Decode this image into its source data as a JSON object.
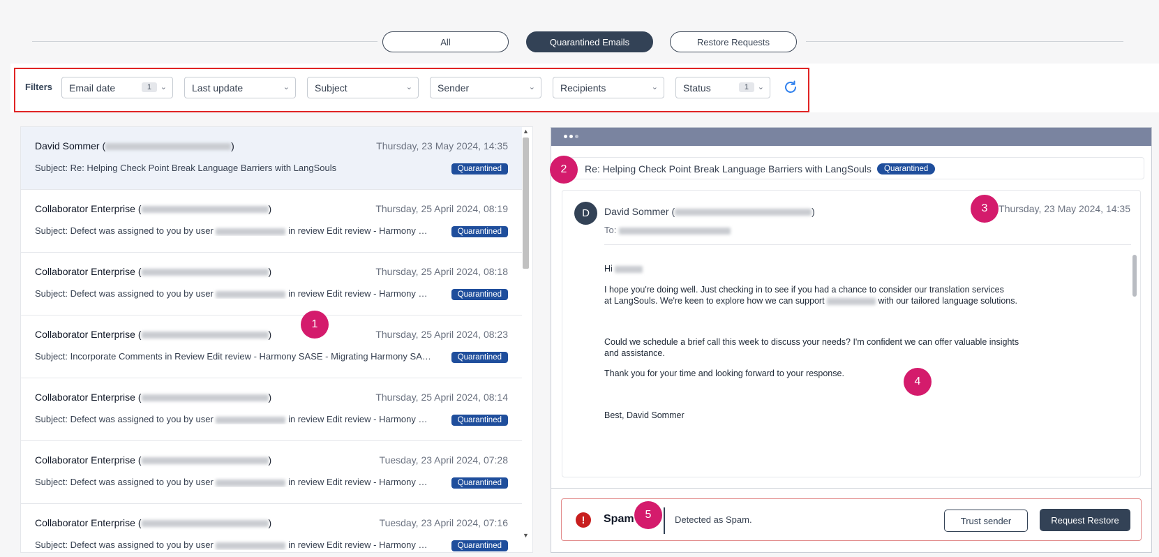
{
  "tabs": [
    {
      "label": "All",
      "active": false
    },
    {
      "label": "Quarantined Emails",
      "active": true
    },
    {
      "label": "Restore Requests",
      "active": false
    }
  ],
  "filters": {
    "label": "Filters",
    "items": [
      {
        "label": "Email date",
        "count": "1"
      },
      {
        "label": "Last update",
        "count": ""
      },
      {
        "label": "Subject",
        "count": ""
      },
      {
        "label": "Sender",
        "count": ""
      },
      {
        "label": "Recipients",
        "count": ""
      },
      {
        "label": "Status",
        "count": "1"
      }
    ]
  },
  "emails": [
    {
      "sender": "David Sommer (",
      "date": "Thursday, 23 May 2024, 14:35",
      "subject": "Subject: Re: Helping Check Point Break Language Barriers with LangSouls",
      "status": "Quarantined"
    },
    {
      "sender": "Collaborator Enterprise (",
      "date": "Thursday, 25 April 2024, 08:19",
      "subject": "Subject: Defect was assigned to you by user",
      "subject_tail": "in review Edit review - Harmony SA...",
      "status": "Quarantined"
    },
    {
      "sender": "Collaborator Enterprise (",
      "date": "Thursday, 25 April 2024, 08:18",
      "subject": "Subject: Defect was assigned to you by user",
      "subject_tail": "in review Edit review - Harmony SA...",
      "status": "Quarantined"
    },
    {
      "sender": "Collaborator Enterprise (",
      "date": "Thursday, 25 April 2024, 08:23",
      "subject": "Subject: Incorporate Comments in Review Edit review - Harmony SASE - Migrating Harmony SASE ...",
      "status": "Quarantined"
    },
    {
      "sender": "Collaborator Enterprise (",
      "date": "Thursday, 25 April 2024, 08:14",
      "subject": "Subject: Defect was assigned to you by user",
      "subject_tail": "in review Edit review - Harmony SA...",
      "status": "Quarantined"
    },
    {
      "sender": "Collaborator Enterprise (",
      "date": "Tuesday, 23 April 2024, 07:28",
      "subject": "Subject: Defect was assigned to you by user",
      "subject_tail": "in review Edit review - Harmony SA...",
      "status": "Quarantined"
    },
    {
      "sender": "Collaborator Enterprise (",
      "date": "Tuesday, 23 April 2024, 07:16",
      "subject": "Subject: Defect was assigned to you by user",
      "subject_tail": "in review Edit review - Harmony SA...",
      "status": "Quarantined"
    }
  ],
  "detail": {
    "subject": "Re: Helping Check Point Break Language Barriers with LangSouls",
    "status": "Quarantined",
    "avatar": "D",
    "from": "David Sommer (",
    "from_close": ")",
    "to_label": "To:",
    "date": "Thursday, 23 May 2024, 14:35",
    "greeting": "Hi",
    "p1a": "I hope you're doing well. Just checking in to see if you had a chance to consider our translation services",
    "p1b": "at LangSouls. We're keen to explore how we can support",
    "p1c": "with our tailored language solutions.",
    "p2a": "Could we schedule a brief call this week to discuss your needs? I'm confident we can offer valuable insights",
    "p2b": "and assistance.",
    "p3": "Thank you for your time and looking forward to your response.",
    "sign": "Best, David Sommer"
  },
  "spam": {
    "title": "Spam",
    "description": "Detected as Spam.",
    "trust_label": "Trust sender",
    "restore_label": "Request Restore"
  },
  "markers": [
    "1",
    "2",
    "3",
    "4",
    "5"
  ]
}
